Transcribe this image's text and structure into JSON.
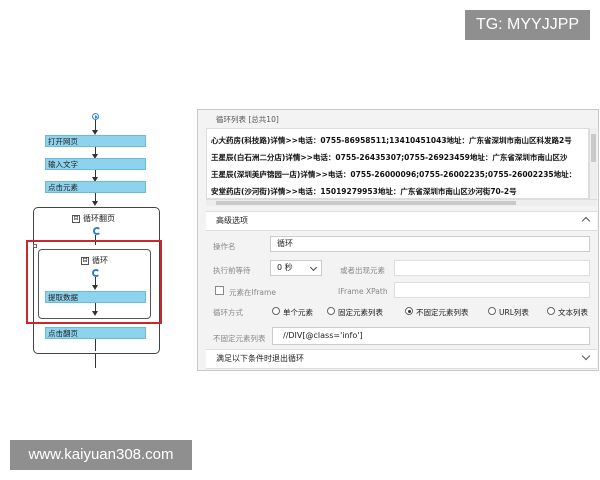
{
  "watermarks": {
    "top": "TG: MYYJJPP",
    "bottom": "www.kaiyuan308.com"
  },
  "flow": {
    "steps": [
      "打开网页",
      "输入文字",
      "点击元素"
    ],
    "loop_outer_title": "循环翻页",
    "loop_inner_title": "循环",
    "extract_label": "提取数据",
    "next_page_label": "点击翻页",
    "collapse_symbol": "⊟"
  },
  "panel": {
    "list_header": "循环列表 [总共10]",
    "list_items": [
      "心大药房(科技路)详情>>电话：0755-86958511;13410451043地址：广东省深圳市南山区科发路2号",
      "王星辰(白石洲二分店)详情>>电话：0755-26435307;0755-26923459地址：广东省深圳市南山区沙",
      "王星辰(深圳美庐锦园一店)详情>>电话：0755-26000096;0755-26002235;0755-26002235地址：",
      "安堂药店(沙河街)详情>>电话：15019279953地址：广东省深圳市南山区沙河街70-2号"
    ],
    "advanced_header": "高级选项",
    "op_name_label": "操作名",
    "op_name_value": "循环",
    "wait_label": "执行前等待",
    "wait_value": "0 秒",
    "or_appear_label": "或者出现元素",
    "or_appear_value": "",
    "iframe_label": "元素在Iframe",
    "iframe_xpath_label": "IFrame XPath",
    "iframe_xpath_value": "",
    "loop_mode_label": "循环方式",
    "loop_modes": [
      "单个元素",
      "固定元素列表",
      "不固定元素列表",
      "URL列表",
      "文本列表"
    ],
    "loop_mode_selected": 2,
    "unfixed_list_label": "不固定元素列表",
    "unfixed_list_value": "//DIV[@class='info']",
    "exit_header": "满足以下条件时退出循环"
  }
}
